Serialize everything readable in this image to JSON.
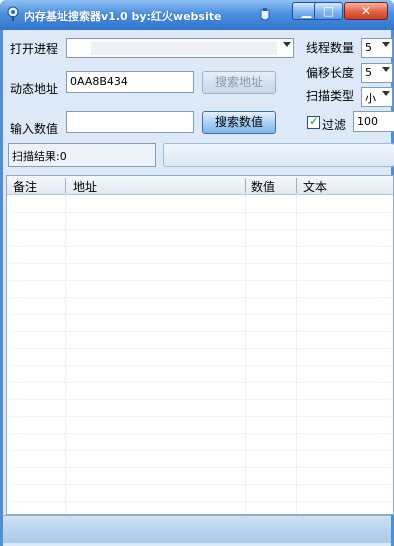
{
  "window": {
    "title": "内存基址搜索器v1.0  by:红火website"
  },
  "form": {
    "process_label": "打开进程",
    "process_value": "",
    "address_label": "动态地址",
    "address_value": "0AA8B434",
    "search_address_button": "搜索地址",
    "value_label": "输入数值",
    "value_value": "",
    "search_value_button": "搜索数值"
  },
  "options": {
    "threads_label": "线程数量",
    "threads_value": "5",
    "offset_label": "偏移长度",
    "offset_value": "5",
    "scan_type_label": "扫描类型",
    "scan_type_value": "小",
    "filter_label": "过滤",
    "filter_checked": true,
    "filter_value": "100"
  },
  "results": {
    "summary": "扫描结果:0",
    "columns": [
      "备注",
      "地址",
      "数值",
      "文本"
    ],
    "rows": []
  }
}
